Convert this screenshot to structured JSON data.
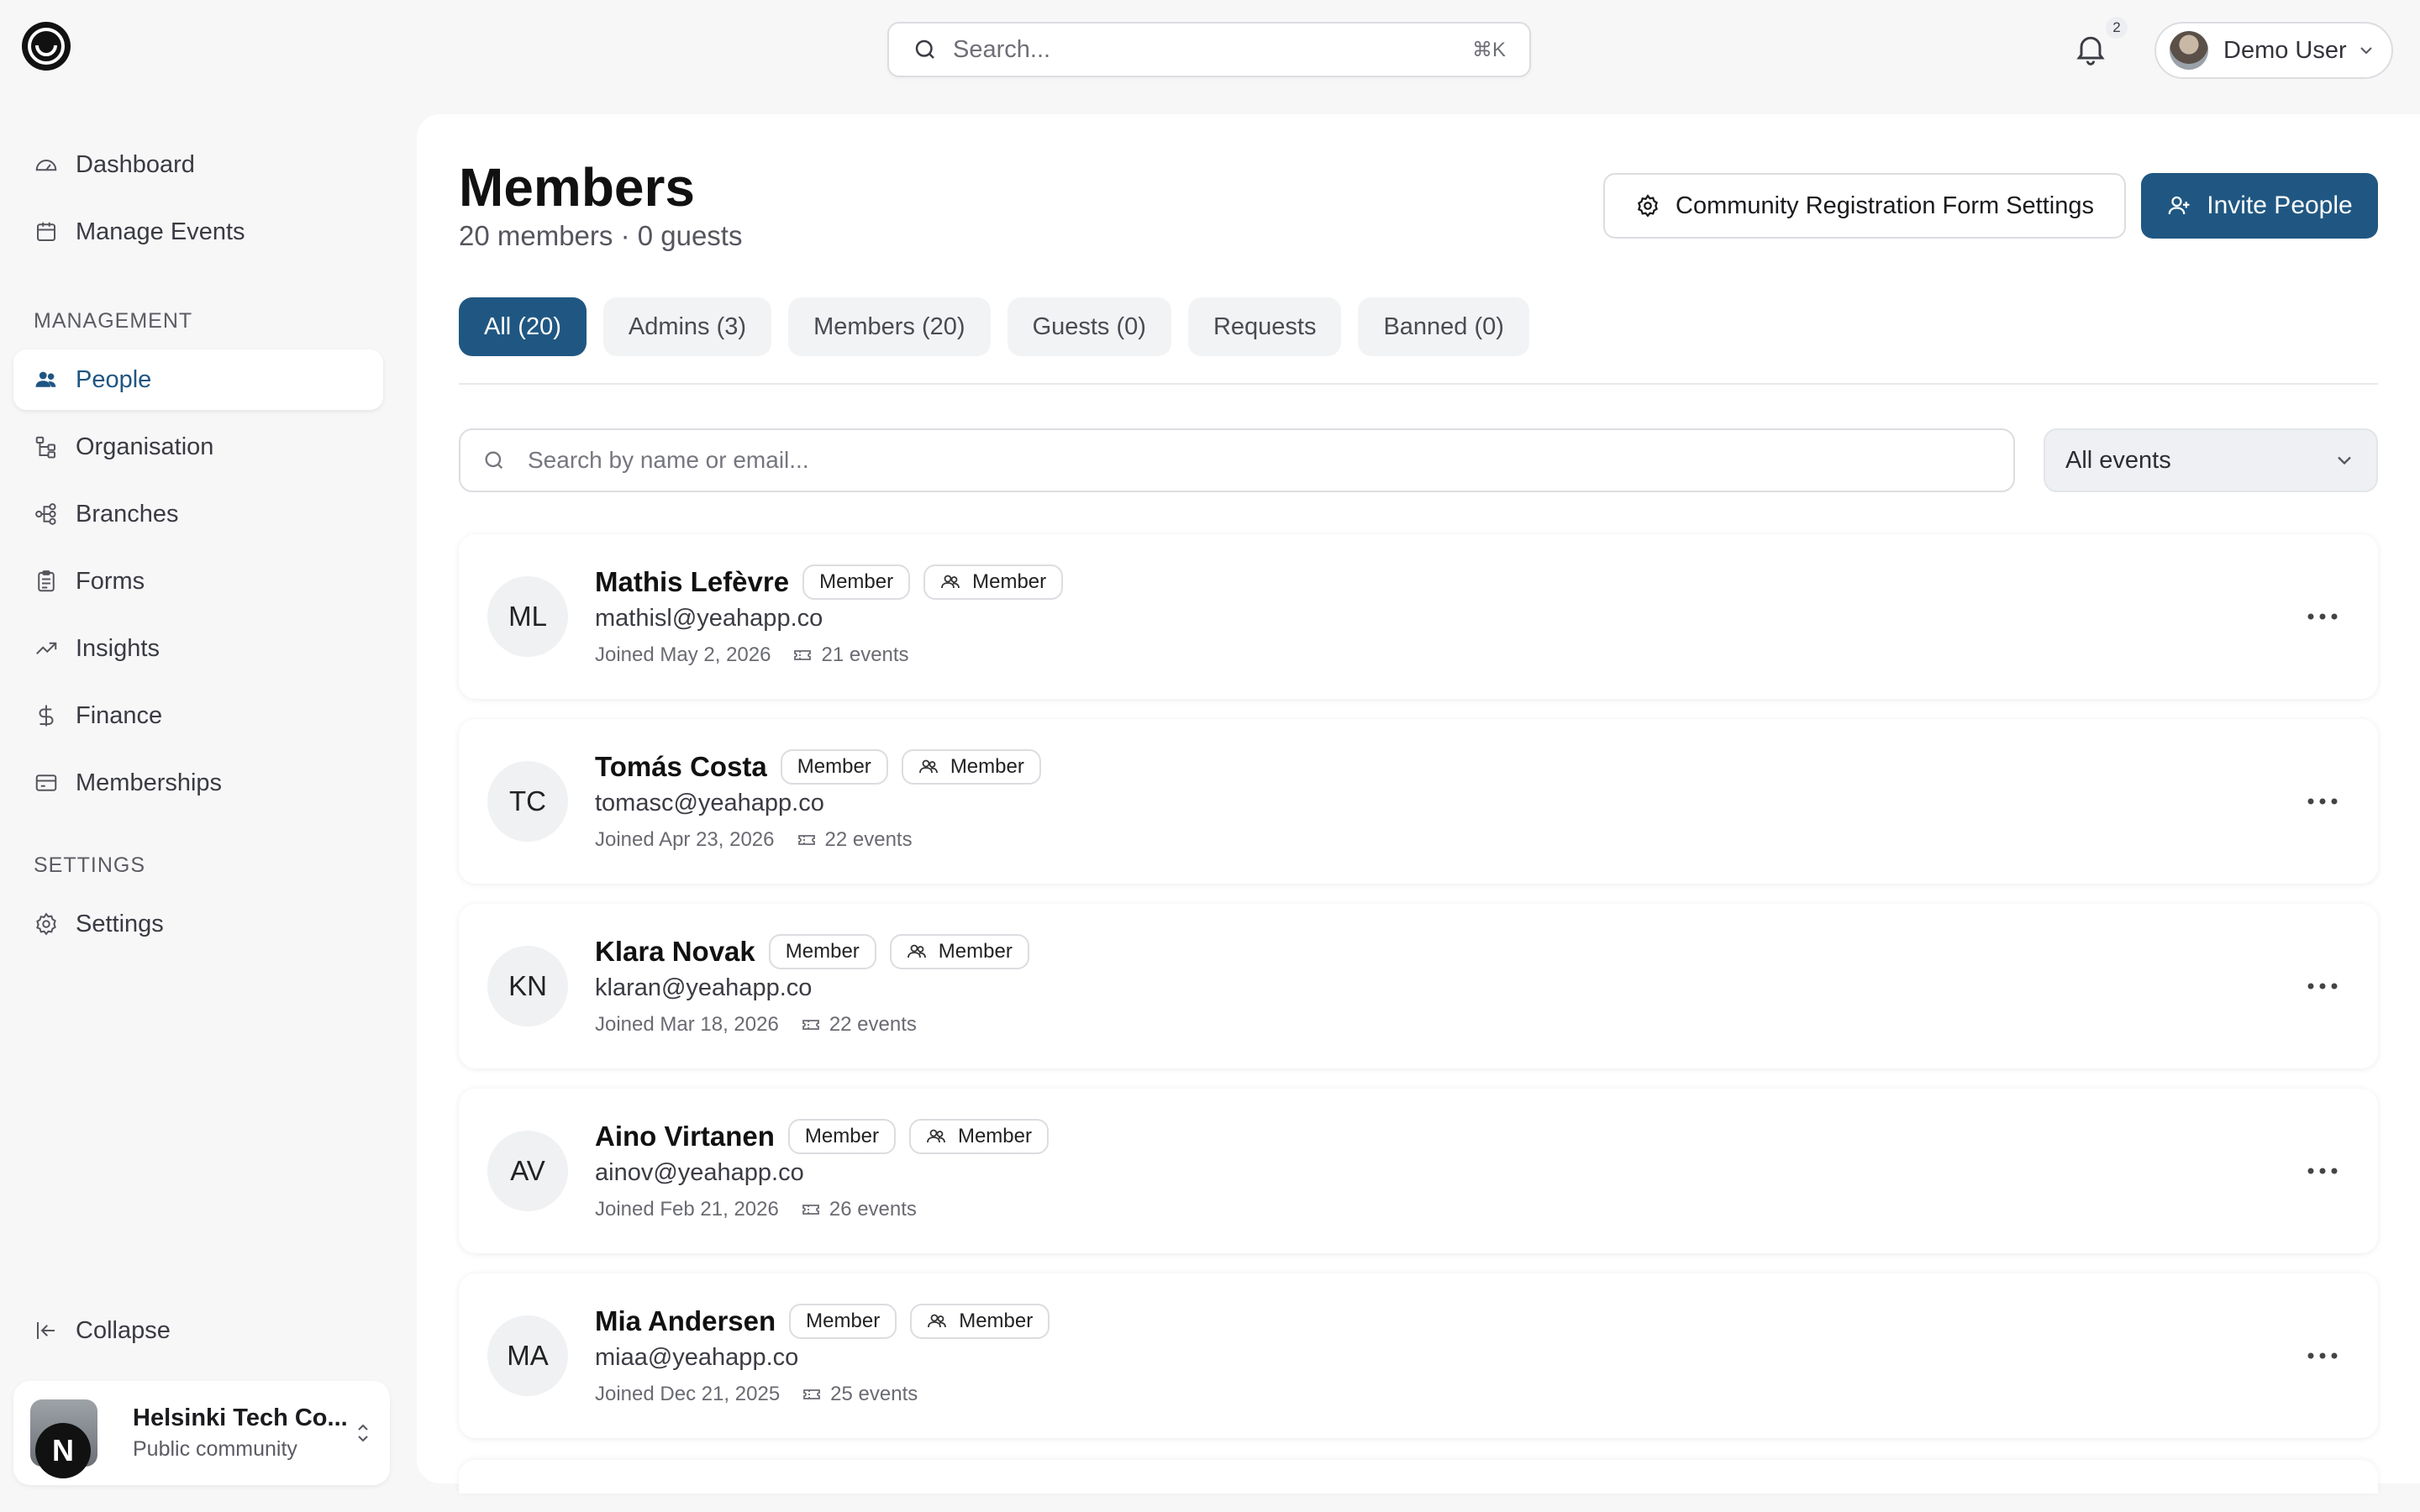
{
  "topbar": {
    "search_placeholder": "Search...",
    "search_shortcut": "⌘K",
    "notification_count": "2",
    "user_name": "Demo User"
  },
  "sidebar": {
    "items_top": [
      {
        "label": "Dashboard",
        "icon": "gauge-icon"
      },
      {
        "label": "Manage Events",
        "icon": "calendar-icon"
      }
    ],
    "management_label": "MANAGEMENT",
    "management_items": [
      {
        "label": "People",
        "icon": "users-icon",
        "active": true
      },
      {
        "label": "Organisation",
        "icon": "hierarchy-icon"
      },
      {
        "label": "Branches",
        "icon": "branches-icon"
      },
      {
        "label": "Forms",
        "icon": "clipboard-icon"
      },
      {
        "label": "Insights",
        "icon": "trend-icon"
      },
      {
        "label": "Finance",
        "icon": "dollar-icon"
      },
      {
        "label": "Memberships",
        "icon": "card-icon"
      }
    ],
    "settings_label": "SETTINGS",
    "settings_items": [
      {
        "label": "Settings",
        "icon": "gear-icon"
      }
    ],
    "collapse_label": "Collapse",
    "community": {
      "name": "Helsinki Tech Co...",
      "subtitle": "Public community",
      "logo_letter": "N"
    }
  },
  "main": {
    "title": "Members",
    "subtitle": "20 members · 0 guests",
    "registration_button": "Community Registration Form Settings",
    "invite_button": "Invite People",
    "tabs": [
      {
        "label": "All (20)",
        "active": true
      },
      {
        "label": "Admins (3)"
      },
      {
        "label": "Members (20)"
      },
      {
        "label": "Guests (0)"
      },
      {
        "label": "Requests"
      },
      {
        "label": "Banned (0)"
      }
    ],
    "member_search_placeholder": "Search by name or email...",
    "events_filter": "All events",
    "members": [
      {
        "initials": "ML",
        "name": "Mathis Lefèvre",
        "role": "Member",
        "type": "Member",
        "email": "mathisl@yeahapp.co",
        "joined": "Joined May 2, 2026",
        "events": "21 events"
      },
      {
        "initials": "TC",
        "name": "Tomás Costa",
        "role": "Member",
        "type": "Member",
        "email": "tomasc@yeahapp.co",
        "joined": "Joined Apr 23, 2026",
        "events": "22 events"
      },
      {
        "initials": "KN",
        "name": "Klara Novak",
        "role": "Member",
        "type": "Member",
        "email": "klaran@yeahapp.co",
        "joined": "Joined Mar 18, 2026",
        "events": "22 events"
      },
      {
        "initials": "AV",
        "name": "Aino Virtanen",
        "role": "Member",
        "type": "Member",
        "email": "ainov@yeahapp.co",
        "joined": "Joined Feb 21, 2026",
        "events": "26 events"
      },
      {
        "initials": "MA",
        "name": "Mia Andersen",
        "role": "Member",
        "type": "Member",
        "email": "miaa@yeahapp.co",
        "joined": "Joined Dec 21, 2025",
        "events": "25 events"
      }
    ]
  },
  "colors": {
    "accent": "#205782",
    "background": "#f7f7f8",
    "panel": "#ffffff"
  }
}
